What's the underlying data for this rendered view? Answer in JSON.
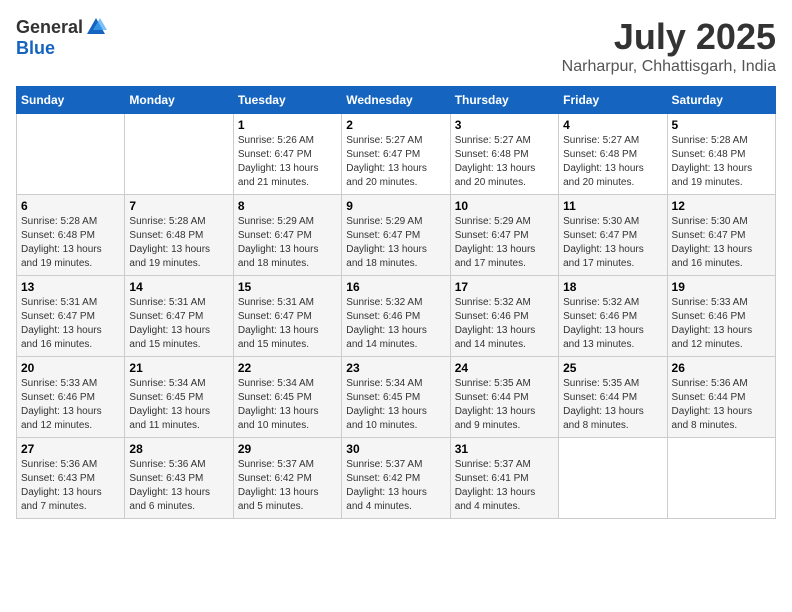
{
  "header": {
    "logo_general": "General",
    "logo_blue": "Blue",
    "month": "July 2025",
    "location": "Narharpur, Chhattisgarh, India"
  },
  "weekdays": [
    "Sunday",
    "Monday",
    "Tuesday",
    "Wednesday",
    "Thursday",
    "Friday",
    "Saturday"
  ],
  "weeks": [
    [
      {
        "day": "",
        "info": ""
      },
      {
        "day": "",
        "info": ""
      },
      {
        "day": "1",
        "info": "Sunrise: 5:26 AM\nSunset: 6:47 PM\nDaylight: 13 hours\nand 21 minutes."
      },
      {
        "day": "2",
        "info": "Sunrise: 5:27 AM\nSunset: 6:47 PM\nDaylight: 13 hours\nand 20 minutes."
      },
      {
        "day": "3",
        "info": "Sunrise: 5:27 AM\nSunset: 6:48 PM\nDaylight: 13 hours\nand 20 minutes."
      },
      {
        "day": "4",
        "info": "Sunrise: 5:27 AM\nSunset: 6:48 PM\nDaylight: 13 hours\nand 20 minutes."
      },
      {
        "day": "5",
        "info": "Sunrise: 5:28 AM\nSunset: 6:48 PM\nDaylight: 13 hours\nand 19 minutes."
      }
    ],
    [
      {
        "day": "6",
        "info": "Sunrise: 5:28 AM\nSunset: 6:48 PM\nDaylight: 13 hours\nand 19 minutes."
      },
      {
        "day": "7",
        "info": "Sunrise: 5:28 AM\nSunset: 6:48 PM\nDaylight: 13 hours\nand 19 minutes."
      },
      {
        "day": "8",
        "info": "Sunrise: 5:29 AM\nSunset: 6:47 PM\nDaylight: 13 hours\nand 18 minutes."
      },
      {
        "day": "9",
        "info": "Sunrise: 5:29 AM\nSunset: 6:47 PM\nDaylight: 13 hours\nand 18 minutes."
      },
      {
        "day": "10",
        "info": "Sunrise: 5:29 AM\nSunset: 6:47 PM\nDaylight: 13 hours\nand 17 minutes."
      },
      {
        "day": "11",
        "info": "Sunrise: 5:30 AM\nSunset: 6:47 PM\nDaylight: 13 hours\nand 17 minutes."
      },
      {
        "day": "12",
        "info": "Sunrise: 5:30 AM\nSunset: 6:47 PM\nDaylight: 13 hours\nand 16 minutes."
      }
    ],
    [
      {
        "day": "13",
        "info": "Sunrise: 5:31 AM\nSunset: 6:47 PM\nDaylight: 13 hours\nand 16 minutes."
      },
      {
        "day": "14",
        "info": "Sunrise: 5:31 AM\nSunset: 6:47 PM\nDaylight: 13 hours\nand 15 minutes."
      },
      {
        "day": "15",
        "info": "Sunrise: 5:31 AM\nSunset: 6:47 PM\nDaylight: 13 hours\nand 15 minutes."
      },
      {
        "day": "16",
        "info": "Sunrise: 5:32 AM\nSunset: 6:46 PM\nDaylight: 13 hours\nand 14 minutes."
      },
      {
        "day": "17",
        "info": "Sunrise: 5:32 AM\nSunset: 6:46 PM\nDaylight: 13 hours\nand 14 minutes."
      },
      {
        "day": "18",
        "info": "Sunrise: 5:32 AM\nSunset: 6:46 PM\nDaylight: 13 hours\nand 13 minutes."
      },
      {
        "day": "19",
        "info": "Sunrise: 5:33 AM\nSunset: 6:46 PM\nDaylight: 13 hours\nand 12 minutes."
      }
    ],
    [
      {
        "day": "20",
        "info": "Sunrise: 5:33 AM\nSunset: 6:46 PM\nDaylight: 13 hours\nand 12 minutes."
      },
      {
        "day": "21",
        "info": "Sunrise: 5:34 AM\nSunset: 6:45 PM\nDaylight: 13 hours\nand 11 minutes."
      },
      {
        "day": "22",
        "info": "Sunrise: 5:34 AM\nSunset: 6:45 PM\nDaylight: 13 hours\nand 10 minutes."
      },
      {
        "day": "23",
        "info": "Sunrise: 5:34 AM\nSunset: 6:45 PM\nDaylight: 13 hours\nand 10 minutes."
      },
      {
        "day": "24",
        "info": "Sunrise: 5:35 AM\nSunset: 6:44 PM\nDaylight: 13 hours\nand 9 minutes."
      },
      {
        "day": "25",
        "info": "Sunrise: 5:35 AM\nSunset: 6:44 PM\nDaylight: 13 hours\nand 8 minutes."
      },
      {
        "day": "26",
        "info": "Sunrise: 5:36 AM\nSunset: 6:44 PM\nDaylight: 13 hours\nand 8 minutes."
      }
    ],
    [
      {
        "day": "27",
        "info": "Sunrise: 5:36 AM\nSunset: 6:43 PM\nDaylight: 13 hours\nand 7 minutes."
      },
      {
        "day": "28",
        "info": "Sunrise: 5:36 AM\nSunset: 6:43 PM\nDaylight: 13 hours\nand 6 minutes."
      },
      {
        "day": "29",
        "info": "Sunrise: 5:37 AM\nSunset: 6:42 PM\nDaylight: 13 hours\nand 5 minutes."
      },
      {
        "day": "30",
        "info": "Sunrise: 5:37 AM\nSunset: 6:42 PM\nDaylight: 13 hours\nand 4 minutes."
      },
      {
        "day": "31",
        "info": "Sunrise: 5:37 AM\nSunset: 6:41 PM\nDaylight: 13 hours\nand 4 minutes."
      },
      {
        "day": "",
        "info": ""
      },
      {
        "day": "",
        "info": ""
      }
    ]
  ]
}
